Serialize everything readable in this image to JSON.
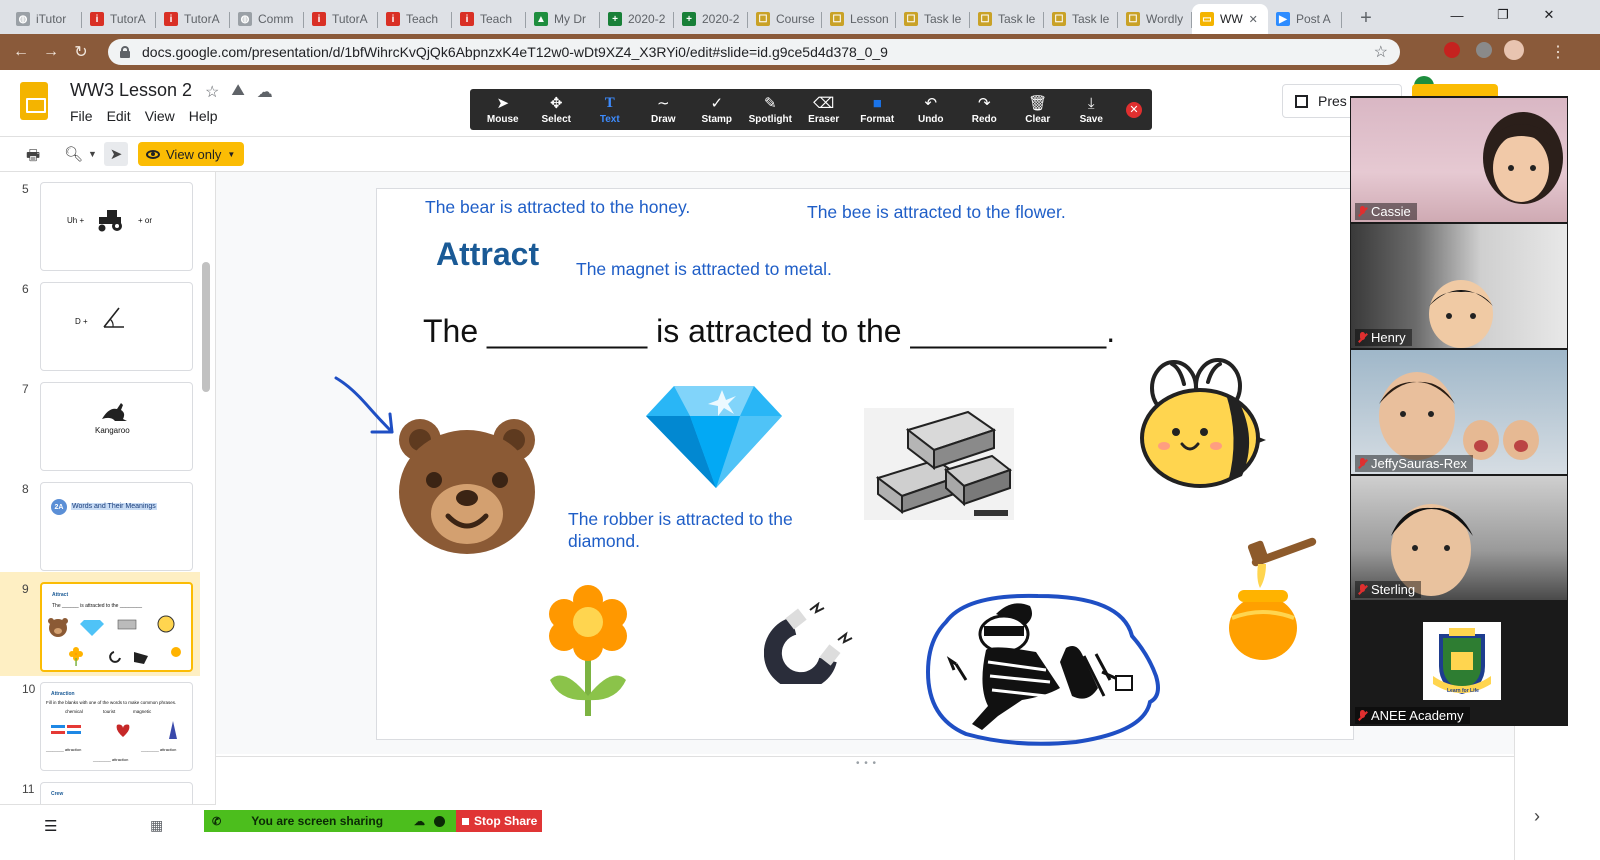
{
  "browser": {
    "tabs": [
      {
        "label": "iTutor",
        "icon": "globe",
        "color": "#9aa0a6"
      },
      {
        "label": "TutorA",
        "icon": "itutor",
        "color": "#d93025"
      },
      {
        "label": "TutorA",
        "icon": "itutor",
        "color": "#d93025"
      },
      {
        "label": "Comm",
        "icon": "globe",
        "color": "#9aa0a6"
      },
      {
        "label": "TutorA",
        "icon": "itutor",
        "color": "#d93025"
      },
      {
        "label": "Teach",
        "icon": "itutor",
        "color": "#d93025"
      },
      {
        "label": "Teach",
        "icon": "itutor",
        "color": "#d93025"
      },
      {
        "label": "My Dr",
        "icon": "drive",
        "color": "#1e8e3e"
      },
      {
        "label": "2020-2",
        "icon": "sheets",
        "color": "#188038"
      },
      {
        "label": "2020-2",
        "icon": "sheets",
        "color": "#188038"
      },
      {
        "label": "Course",
        "icon": "classroom",
        "color": "#c9a227"
      },
      {
        "label": "Lesson",
        "icon": "classroom",
        "color": "#c9a227"
      },
      {
        "label": "Task le",
        "icon": "classroom",
        "color": "#c9a227"
      },
      {
        "label": "Task le",
        "icon": "classroom",
        "color": "#c9a227"
      },
      {
        "label": "Task le",
        "icon": "classroom",
        "color": "#c9a227"
      },
      {
        "label": "Wordly",
        "icon": "classroom",
        "color": "#c9a227"
      },
      {
        "label": "WW",
        "icon": "slides",
        "color": "#f4b400",
        "active": true
      },
      {
        "label": "Post A",
        "icon": "zoom",
        "color": "#2d8cff"
      }
    ],
    "url": "docs.google.com/presentation/d/1bfWihrcKvQjQk6AbpnzxK4eT12w0-wDt9XZ4_X3RYi0/edit#slide=id.g9ce5d4d378_0_9"
  },
  "header": {
    "doc_title": "WW3 Lesson 2",
    "menu": [
      "File",
      "Edit",
      "View",
      "Help"
    ],
    "view_only_label": "View only",
    "present_label": "Pres"
  },
  "annotation_toolbar": {
    "items": [
      {
        "label": "Mouse",
        "icon": "cursor"
      },
      {
        "label": "Select",
        "icon": "move"
      },
      {
        "label": "Text",
        "icon": "text",
        "selected": true
      },
      {
        "label": "Draw",
        "icon": "squiggle"
      },
      {
        "label": "Stamp",
        "icon": "check"
      },
      {
        "label": "Spotlight",
        "icon": "wand"
      },
      {
        "label": "Eraser",
        "icon": "eraser"
      },
      {
        "label": "Format",
        "icon": "format"
      },
      {
        "label": "Undo",
        "icon": "undo"
      },
      {
        "label": "Redo",
        "icon": "redo"
      },
      {
        "label": "Clear",
        "icon": "trash"
      },
      {
        "label": "Save",
        "icon": "save"
      }
    ]
  },
  "filmstrip": {
    "slides": [
      {
        "number": "5",
        "text_a": "Uh +",
        "text_b": "+ or"
      },
      {
        "number": "6",
        "text_a": "D +",
        "text_b": ""
      },
      {
        "number": "7",
        "text_a": "Kangaroo",
        "text_b": ""
      },
      {
        "number": "8",
        "text_a": "2A",
        "text_b": "Words and Their Meanings"
      },
      {
        "number": "9",
        "text_a": "Attract",
        "text_b": "The ______ is attracted to the ________",
        "selected": true
      },
      {
        "number": "10",
        "text_a": "Attraction",
        "text_b": "Fill in the blanks with one of the words to make common phrases."
      },
      {
        "number": "11",
        "text_a": "Crew",
        "text_b": ""
      }
    ],
    "slide10_words": [
      "chemical",
      "tourist",
      "magnetic"
    ],
    "slide10_fill": [
      "________ attraction",
      "________ attraction",
      "________ attraction"
    ]
  },
  "slide": {
    "heading": "Attract",
    "sentence": "The _________ is attracted to the ___________.",
    "annotations": [
      "The bear is attracted to the honey.",
      "The bee is attracted to the flower.",
      "The magnet is attracted to metal.",
      "The robber is attracted to the diamond."
    ]
  },
  "sharing": {
    "status": "You are screen sharing",
    "stop_label": "Stop Share"
  },
  "gallery": {
    "participants": [
      "Cassie",
      "Henry",
      "JeffySauras-Rex",
      "Sterling",
      "ANEE Academy"
    ],
    "logo_text": "Learn for Life"
  },
  "colors": {
    "annotation_blue": "#1f5ec7",
    "heading_blue": "#1a5a96",
    "share_green": "#4cbe1d",
    "stop_red": "#e03535",
    "slides_yellow": "#fbbc04"
  }
}
